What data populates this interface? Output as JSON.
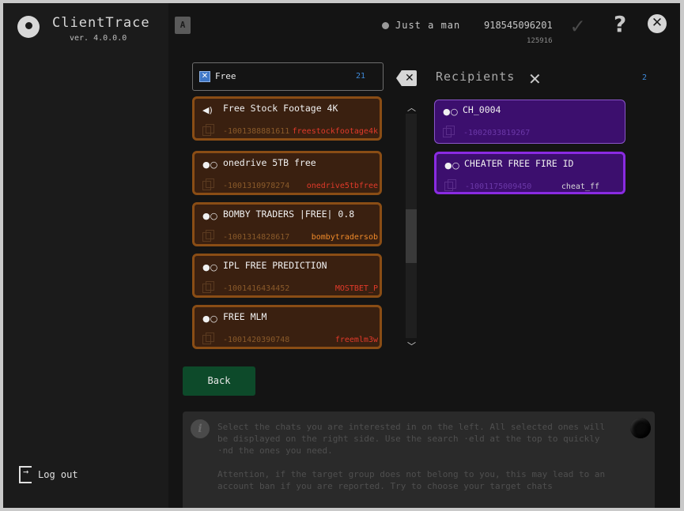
{
  "app": {
    "title": "ClientTrace",
    "version": "ver. 4.0.0.0"
  },
  "header": {
    "user_name": "Just a man",
    "user_id": "918545096201",
    "user_sub": "125916"
  },
  "search": {
    "value": "Free",
    "count": "21"
  },
  "results": [
    {
      "title": "Free Stock Footage 4K",
      "id": "-1001388881611",
      "username": "freestockfootage4k",
      "username_color": "#e03a2a",
      "icon": "megaphone-icon"
    },
    {
      "title": "onedrive 5TB free",
      "id": "-1001310978274",
      "username": "onedrive5tbfree",
      "username_color": "#e03a2a",
      "icon": "group-icon"
    },
    {
      "title": "BOMBY TRADERS |FREE| 0.8",
      "id": "-1001314828617",
      "username": "bombytradersob",
      "username_color": "#f08a2a",
      "icon": "group-icon"
    },
    {
      "title": "IPL FREE PREDICTION",
      "id": "-1001416434452",
      "username": "MOSTBET_P",
      "username_color": "#e03a2a",
      "icon": "group-icon"
    },
    {
      "title": "FREE MLM",
      "id": "-1001420390748",
      "username": "freemlm3w",
      "username_color": "#e03a2a",
      "icon": "group-icon"
    }
  ],
  "recipients": {
    "title": "Recipients",
    "count": "2",
    "items": [
      {
        "title": "CH_0004",
        "id": "-1002033819267",
        "username": ""
      },
      {
        "title": "CHEATER FREE FIRE ID",
        "id": "-1001175009450",
        "username": "cheat_ff"
      }
    ]
  },
  "actions": {
    "back_label": "Back",
    "logout_label": "Log out"
  },
  "info": {
    "paragraph1": "Select the chats you are interested in on the left. All selected ones will be displayed on the right side. Use the search ·eld at the top to quickly ·nd the ones you need.",
    "paragraph2": "Attention, if the target group does not belong to you, this may lead to an account ban if you are reported. Try to choose your target chats"
  },
  "colors": {
    "card_border": "#8a4d15",
    "card_bg": "#3a2010",
    "recipient_bg": "#3c0f6e",
    "recipient_selected_border": "#8a2be2",
    "back_bg": "#0d4a2a",
    "accent": "#3f89d8"
  }
}
